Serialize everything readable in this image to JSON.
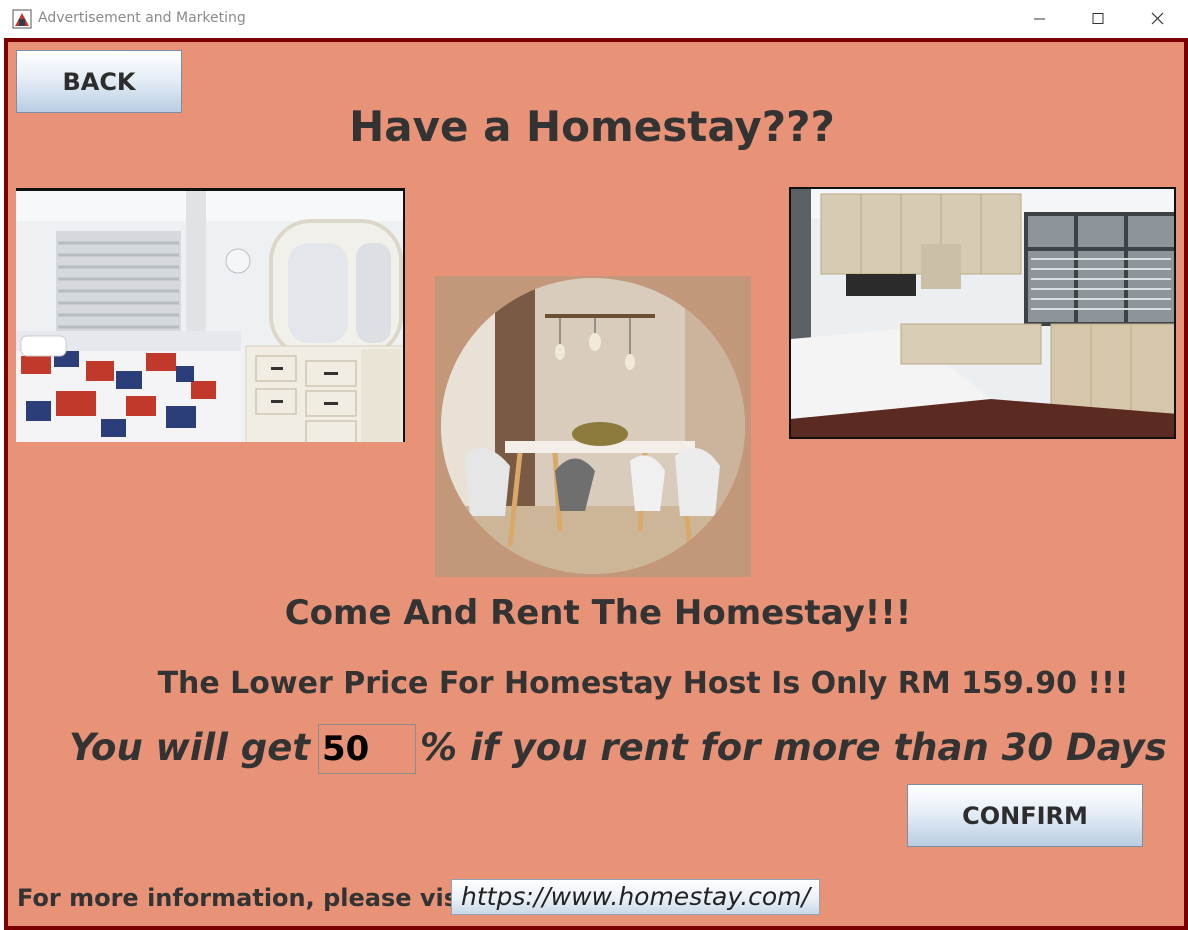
{
  "window": {
    "title": "Advertisement and Marketing",
    "controls": [
      "minimize-icon",
      "maximize-icon",
      "close-icon"
    ]
  },
  "toolbar": {
    "back_label": "BACK"
  },
  "main": {
    "title": "Have a Homestay???",
    "subtitle": "Come And Rent The Homestay!!!",
    "price_text": "The Lower Price For Homestay Host Is Only  RM 159.90 !!!",
    "offer_prefix": "You will get",
    "discount_value": "50",
    "offer_suffix": "% if you rent for more than 30 Days",
    "confirm_label": "CONFIRM"
  },
  "footer": {
    "info_label": "For more information, please visit",
    "url": "https://www.homestay.com/"
  },
  "colors": {
    "background": "#e89377",
    "frame_border": "#7a0000",
    "text": "#333333"
  }
}
